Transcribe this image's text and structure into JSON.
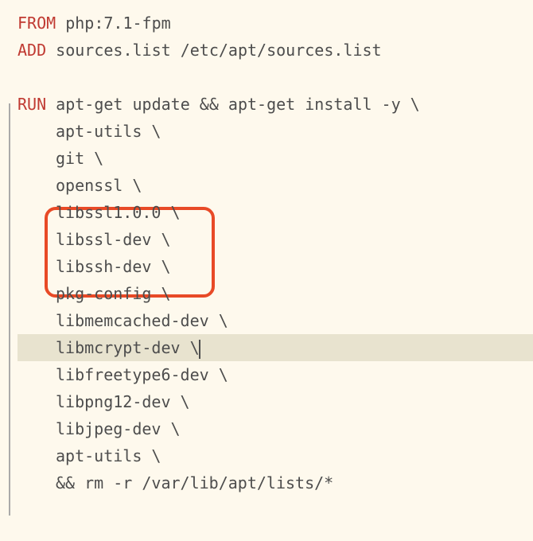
{
  "code": {
    "line1_kw": "FROM",
    "line1_txt": " php:7.1-fpm",
    "line2_kw": "ADD",
    "line2_txt": " sources.list /etc/apt/sources.list",
    "line3_kw": "RUN",
    "line3_txt": " apt-get update && apt-get install -y \\",
    "indent_lines": [
      "apt-utils \\",
      "git \\",
      "openssl \\",
      "libssl1.0.0 \\",
      "libssl-dev \\",
      "libssh-dev \\",
      "pkg-config \\",
      "libmemcached-dev \\",
      "libmcrypt-dev \\",
      "libfreetype6-dev \\",
      "libpng12-dev \\",
      "libjpeg-dev \\",
      "apt-utils \\",
      "&& rm -r /var/lib/apt/lists/*"
    ]
  }
}
